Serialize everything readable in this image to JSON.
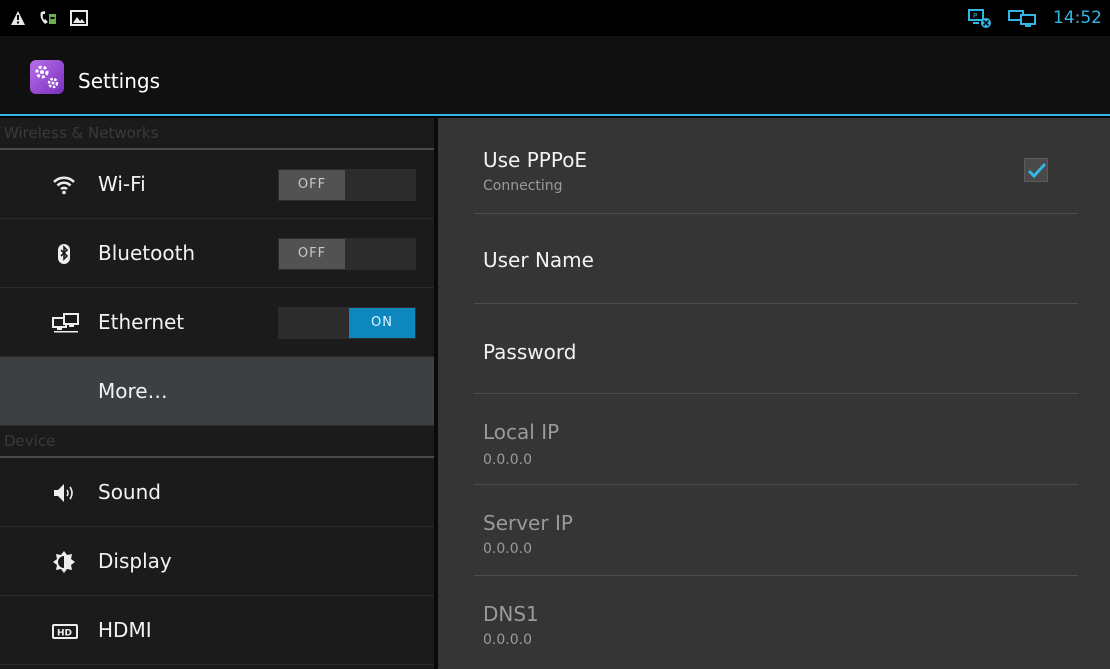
{
  "status_bar": {
    "time": "14:52",
    "left_icons": [
      "warning-icon",
      "phone-call-icon",
      "image-icon"
    ],
    "right_icons": [
      "ethernet-disconnected-icon",
      "network-computers-icon"
    ]
  },
  "action_bar": {
    "title": "Settings",
    "icon": "settings-app-icon"
  },
  "sidebar": {
    "sections": [
      {
        "header": "Wireless & Networks"
      },
      {
        "header": "Device"
      }
    ],
    "items": [
      {
        "label": "Wi-Fi",
        "icon": "wifi-icon",
        "toggle": "OFF"
      },
      {
        "label": "Bluetooth",
        "icon": "bluetooth-icon",
        "toggle": "OFF"
      },
      {
        "label": "Ethernet",
        "icon": "ethernet-icon",
        "toggle": "ON"
      },
      {
        "label": "More…"
      },
      {
        "label": "Sound",
        "icon": "speaker-icon"
      },
      {
        "label": "Display",
        "icon": "brightness-icon"
      },
      {
        "label": "HDMI",
        "icon": "hdmi-icon"
      }
    ]
  },
  "detail": {
    "use_pppoe": {
      "title": "Use PPPoE",
      "summary": "Connecting",
      "checked": true
    },
    "user_name": {
      "title": "User Name"
    },
    "password": {
      "title": "Password"
    },
    "local_ip": {
      "title": "Local IP",
      "value": "0.0.0.0"
    },
    "server_ip": {
      "title": "Server IP",
      "value": "0.0.0.0"
    },
    "dns1": {
      "title": "DNS1",
      "value": "0.0.0.0"
    }
  },
  "colors": {
    "accent": "#33b5e5",
    "toggle_on": "#0e87bf",
    "background_left": "#1b1b1b",
    "background_right": "#353535"
  }
}
